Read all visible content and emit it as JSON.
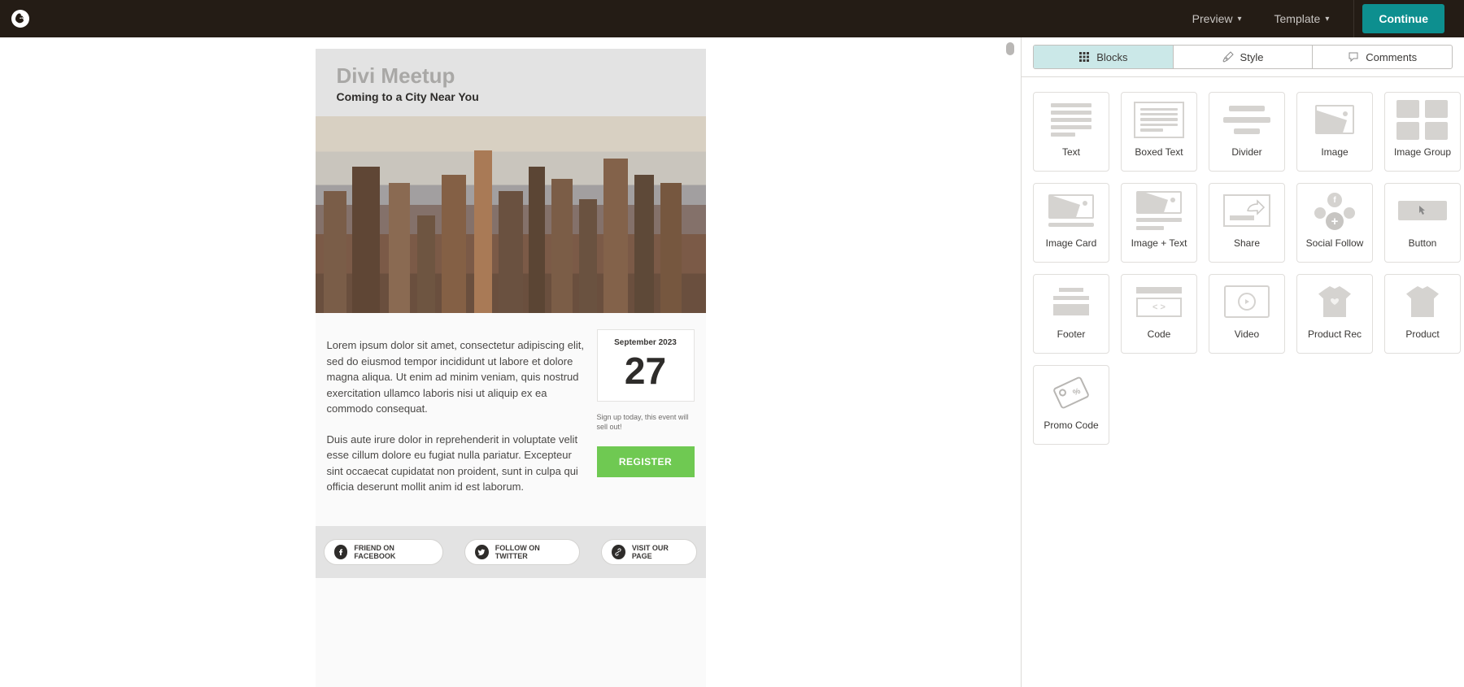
{
  "topbar": {
    "preview": "Preview",
    "template": "Template",
    "continue": "Continue"
  },
  "tabs": {
    "blocks": "Blocks",
    "style": "Style",
    "comments": "Comments"
  },
  "blocks": {
    "text": "Text",
    "boxed_text": "Boxed Text",
    "divider": "Divider",
    "image": "Image",
    "image_group": "Image Group",
    "image_card": "Image Card",
    "image_text": "Image + Text",
    "share": "Share",
    "social_follow": "Social Follow",
    "button": "Button",
    "footer": "Footer",
    "code": "Code",
    "video": "Video",
    "product_rec": "Product Rec",
    "product": "Product",
    "promo_code": "Promo Code"
  },
  "email": {
    "title": "Divi Meetup",
    "subtitle": "Coming to a City Near You",
    "para1": "Lorem ipsum dolor sit amet, consectetur adipiscing elit, sed do eiusmod tempor incididunt ut labore et dolore magna aliqua. Ut enim ad minim veniam, quis nostrud exercitation ullamco laboris nisi ut aliquip ex ea commodo consequat.",
    "para2": "Duis aute irure dolor in reprehenderit in voluptate velit esse cillum dolore eu fugiat nulla pariatur. Excepteur sint occaecat cupidatat non proident, sunt in culpa qui officia deserunt mollit anim id est laborum.",
    "date_month": "September 2023",
    "date_day": "27",
    "signup": "Sign up today, this event will sell out!",
    "register": "REGISTER",
    "social_fb": "FRIEND ON FACEBOOK",
    "social_tw": "FOLLOW ON TWITTER",
    "social_web": "VISIT OUR PAGE"
  },
  "code_glyph": "< >"
}
